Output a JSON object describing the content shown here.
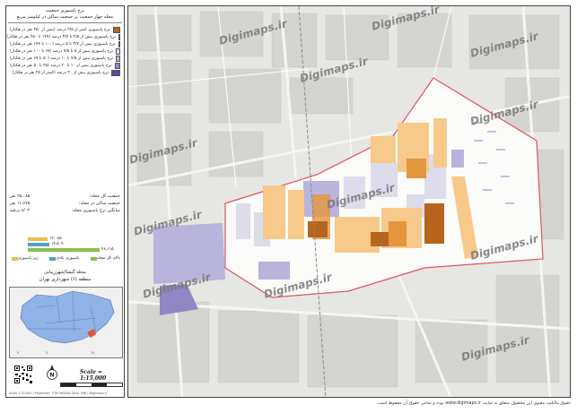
{
  "panel": {
    "title_1": "نرخ پاسپوزی جمعیت",
    "title_2": "محله چهار جمعیت بر جمعیت ساکن در کیلومتر مربع",
    "legend": [
      {
        "label": "نرخ پاسپوزی کمتر از ۲/۵ درصد (بیش از ۲۵۰ نفر در هکتار)",
        "color": "#b5651d"
      },
      {
        "label": "نرخ پاسپوزی بیش از ۲/۵ تا ۳/۷ درصد (۱۴۷ تا ۲۵۰ نفر در هکتار)",
        "color": "#e3963c"
      },
      {
        "label": "نرخ پاسپوزی بیش از ۳/۷ تا ۵ درصد (۱۰۰ تا ۱۴۷ نفر در هکتار)",
        "color": "#f7c98a"
      },
      {
        "label": "نرخ پاسپوزی بیش از ۵ تا ۷/۵ درصد (۶۷ تا ۱۰۰ نفر در هکتار)",
        "color": "#dcdcea"
      },
      {
        "label": "نرخ پاسپوزی بیش از ۷/۵ تا ۱۰ درصد (۵۰ تا ۶۷ نفر در هکتار)",
        "color": "#b8b4dc"
      },
      {
        "label": "نرخ پاسپوزی بیش از ۱۰ تا ۲۰ درصد (۲۵ تا ۵۰ نفر در هکتار)",
        "color": "#8f86c4"
      },
      {
        "label": "نرخ پاسپوزی بیش از ۲۰ درصد (کمتر از ۲۵ نفر در هکتار)",
        "color": "#5a4a9c"
      }
    ],
    "stats": [
      {
        "label": "جمعیت کل محله:",
        "value": "۲۵،۰۸۵ نفر"
      },
      {
        "label": "جمعیت ساکن در محله:",
        "value": "۱۶،۶۷۵ نفر"
      },
      {
        "label": "میانگین نرخ پاسپوزی محله:",
        "value": "۶/۰۳ درصد"
      }
    ],
    "bars": {
      "values": [
        {
          "label": "۱۳،۰۸۵",
          "value": 13085,
          "color": "#e8c04a"
        },
        {
          "label": "۱۴،۵۰۹",
          "value": 14509,
          "color": "#4aa3c4"
        },
        {
          "label": "۴۸،۱۱۵",
          "value": 48115,
          "color": "#8cc04a"
        }
      ],
      "legend": [
        "زیر پاسپوزی",
        "پاسپوزی عادی",
        "بالای کل محله"
      ]
    },
    "location_title": "محله گیشا/شهرزیبایی",
    "location_subtitle": "منطقه (۶) شهرداری تهران",
    "scale_text": "Scale = 1:15,000",
    "north_label": "N",
    "credit": "Scale 1:15,000 | Projection: UTM WGS84 Zone 39N | Digimaps.ir"
  },
  "map": {
    "watermarks": [
      "Digimaps.ir",
      "Digimaps.ir",
      "Digimaps.ir",
      "Digimaps.ir",
      "Digimaps.ir",
      "Digimaps.ir",
      "Digimaps.ir",
      "Digimaps.ir",
      "Digimaps.ir",
      "Digimaps.ir",
      "Digimaps.ir",
      "Digimaps.ir"
    ]
  },
  "footer": "حقوق مالکیت معنوی این محصول متعلق به سایت www.digimaps.ir بوده و تمامی حقوق آن محفوظ است."
}
